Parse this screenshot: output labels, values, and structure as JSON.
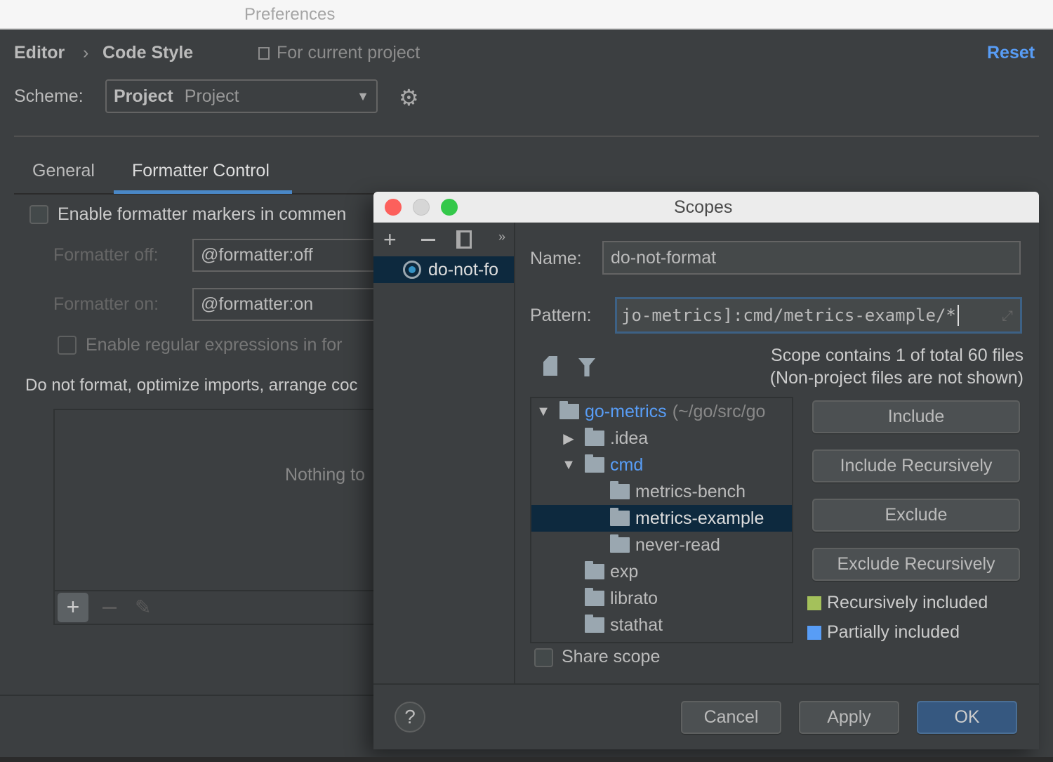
{
  "window": {
    "title": "Preferences"
  },
  "header": {
    "breadcrumb": [
      "Editor",
      "Code Style"
    ],
    "separator": "›",
    "scope_hint": "For current project",
    "reset": "Reset"
  },
  "scheme": {
    "label": "Scheme:",
    "value_bold": "Project",
    "value": "Project"
  },
  "tabs": [
    {
      "label": "General",
      "active": false
    },
    {
      "label": "Formatter Control",
      "active": true
    }
  ],
  "formatter": {
    "enable_markers": "Enable formatter markers in commen",
    "off_label": "Formatter off:",
    "off_value": "@formatter:off",
    "on_label": "Formatter on:",
    "on_value": "@formatter:on",
    "enable_regex": "Enable regular expressions in for",
    "do_not_format": "Do not format, optimize imports, arrange coc",
    "empty_text": "Nothing to"
  },
  "dialog": {
    "title": "Scopes",
    "scopes": [
      {
        "name": "do-not-fo",
        "selected": true
      }
    ],
    "name_label": "Name:",
    "name_value": "do-not-format",
    "pattern_label": "Pattern:",
    "pattern_value": "jo-metrics]:cmd/metrics-example/*",
    "summary_line1": "Scope contains 1 of total 60 files",
    "summary_line2": "(Non-project files are not shown)",
    "tree": [
      {
        "label": "go-metrics",
        "suffix": "(~/go/src/go",
        "level": 0,
        "expanded": true,
        "highlight": true
      },
      {
        "label": ".idea",
        "level": 1,
        "expanded": false
      },
      {
        "label": "cmd",
        "level": 1,
        "expanded": true,
        "highlight": true
      },
      {
        "label": "metrics-bench",
        "level": 2
      },
      {
        "label": "metrics-example",
        "level": 2,
        "selected": true
      },
      {
        "label": "never-read",
        "level": 2
      },
      {
        "label": "exp",
        "level": 1
      },
      {
        "label": "librato",
        "level": 1
      },
      {
        "label": "stathat",
        "level": 1
      }
    ],
    "buttons": {
      "include": "Include",
      "include_rec": "Include Recursively",
      "exclude": "Exclude",
      "exclude_rec": "Exclude Recursively"
    },
    "legend": [
      {
        "label": "Recursively included",
        "color": "#a4c15b"
      },
      {
        "label": "Partially included",
        "color": "#589df6"
      }
    ],
    "share_scope": "Share scope",
    "footer": {
      "cancel": "Cancel",
      "apply": "Apply",
      "ok": "OK",
      "help": "?"
    }
  },
  "colors": {
    "accent": "#589df6",
    "selection": "#0d293e",
    "ok": "#365880",
    "tab_underline": "#4a88c7"
  }
}
